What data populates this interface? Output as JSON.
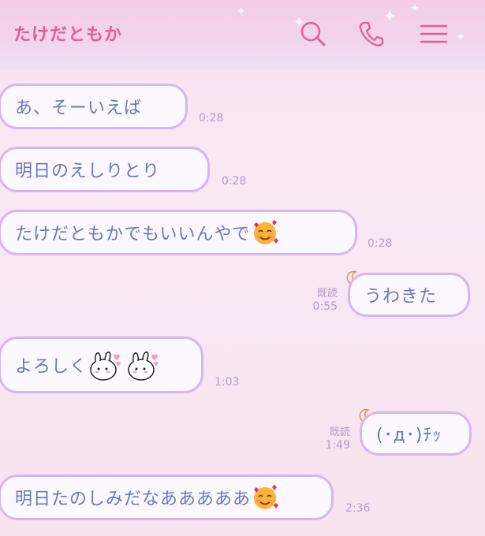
{
  "header": {
    "title": "たけだともか",
    "icons": [
      "search-icon",
      "phone-icon",
      "menu-icon"
    ]
  },
  "messages": [
    {
      "side": "left",
      "text": "あ、そーいえば",
      "time": "0:28"
    },
    {
      "side": "left",
      "text": "明日のえしりとり",
      "time": "0:28"
    },
    {
      "side": "left",
      "text": "たけだともかでもいいんやで",
      "emoji": "smiling-face-with-hearts",
      "time": "0:28"
    },
    {
      "side": "right",
      "text": "うわきた",
      "read": "既読",
      "time": "0:55"
    },
    {
      "side": "left",
      "text": "よろしく",
      "stickers": [
        "bunny-kiss-sticker",
        "bunny-kiss-sticker"
      ],
      "time": "1:03"
    },
    {
      "side": "right",
      "text": "(･д･)ﾁｯ",
      "read": "既読",
      "time": "1:49"
    },
    {
      "side": "left",
      "text": "明日たのしみだなあああああ",
      "emoji": "smiling-face-with-hearts",
      "time": "2:36"
    }
  ],
  "colors": {
    "accent": "#e0609a",
    "bubble_border": "#d7b6ee",
    "text": "#6a78b8",
    "time": "#b49bc4"
  }
}
